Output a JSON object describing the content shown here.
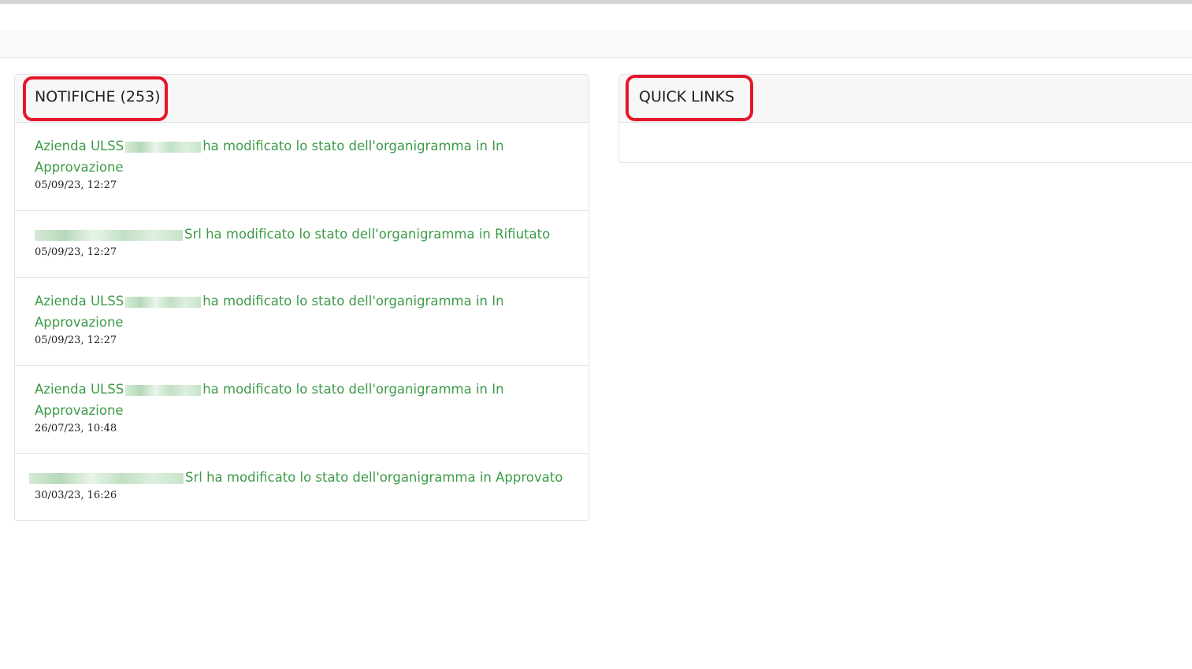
{
  "notifications_panel": {
    "title": "NOTIFICHE (253)",
    "items": [
      {
        "prefix": "Azienda ULSS",
        "text": "ha modificato lo stato dell'organigramma in In Approvazione",
        "time": "05/09/23, 12:27"
      },
      {
        "prefix": "",
        "text": "Srl ha modificato lo stato dell'organigramma in Rifiutato",
        "time": "05/09/23, 12:27"
      },
      {
        "prefix": "Azienda ULSS",
        "text": "ha modificato lo stato dell'organigramma in In Approvazione",
        "time": "05/09/23, 12:27"
      },
      {
        "prefix": "Azienda ULSS",
        "text": "ha modificato lo stato dell'organigramma in In Approvazione",
        "time": "26/07/23, 10:48"
      },
      {
        "prefix": "",
        "text": "Srl ha modificato lo stato dell'organigramma in Approvato",
        "time": "30/03/23, 16:26"
      }
    ]
  },
  "quick_links_panel": {
    "title": "QUICK LINKS"
  },
  "colors": {
    "link_green": "#3d9b47",
    "highlight_red": "#e5172a"
  }
}
